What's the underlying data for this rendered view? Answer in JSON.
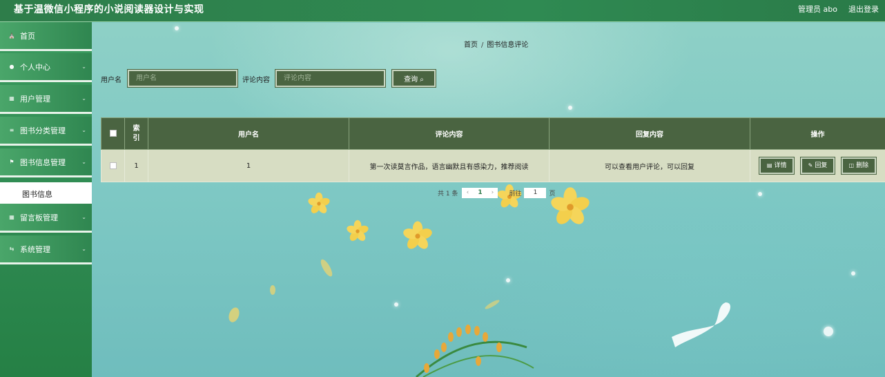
{
  "header": {
    "title": "基于温微信小程序的小说阅读器设计与实现",
    "admin_label": "管理员 abo",
    "logout_label": "退出登录"
  },
  "sidebar": {
    "items": [
      {
        "label": "首页",
        "icon": "home-icon"
      },
      {
        "label": "个人中心",
        "icon": "user-icon"
      },
      {
        "label": "用户管理",
        "icon": "grid-icon"
      },
      {
        "label": "图书分类管理",
        "icon": "list-icon"
      },
      {
        "label": "图书信息管理",
        "icon": "flag-icon"
      },
      {
        "label": "留言板管理",
        "icon": "grid-icon"
      },
      {
        "label": "系统管理",
        "icon": "sliders-icon"
      }
    ],
    "active_submenu": "图书信息"
  },
  "breadcrumb": {
    "home": "首页",
    "separator": "/",
    "current": "图书信息评论"
  },
  "search": {
    "username_label": "用户名",
    "username_placeholder": "用户名",
    "comment_label": "评论内容",
    "comment_placeholder": "评论内容",
    "button_label": "查询"
  },
  "table": {
    "headers": {
      "index": "索引",
      "username": "用户名",
      "comment": "评论内容",
      "reply": "回复内容",
      "actions": "操作"
    },
    "rows": [
      {
        "index": "1",
        "username": "1",
        "comment": "第一次读莫言作品，语言幽默且有感染力，推荐阅读",
        "reply": "可以查看用户评论，可以回复"
      }
    ],
    "actions": {
      "detail": "详情",
      "reply": "回复",
      "delete": "删除"
    }
  },
  "pagination": {
    "total_text": "共 1 条",
    "current_page": "1",
    "goto_label": "前往",
    "goto_value": "1",
    "page_suffix": "页"
  },
  "colors": {
    "header_green": "#2f8a52",
    "button_green": "#4a6441",
    "row_bg": "#d7ddc3"
  }
}
